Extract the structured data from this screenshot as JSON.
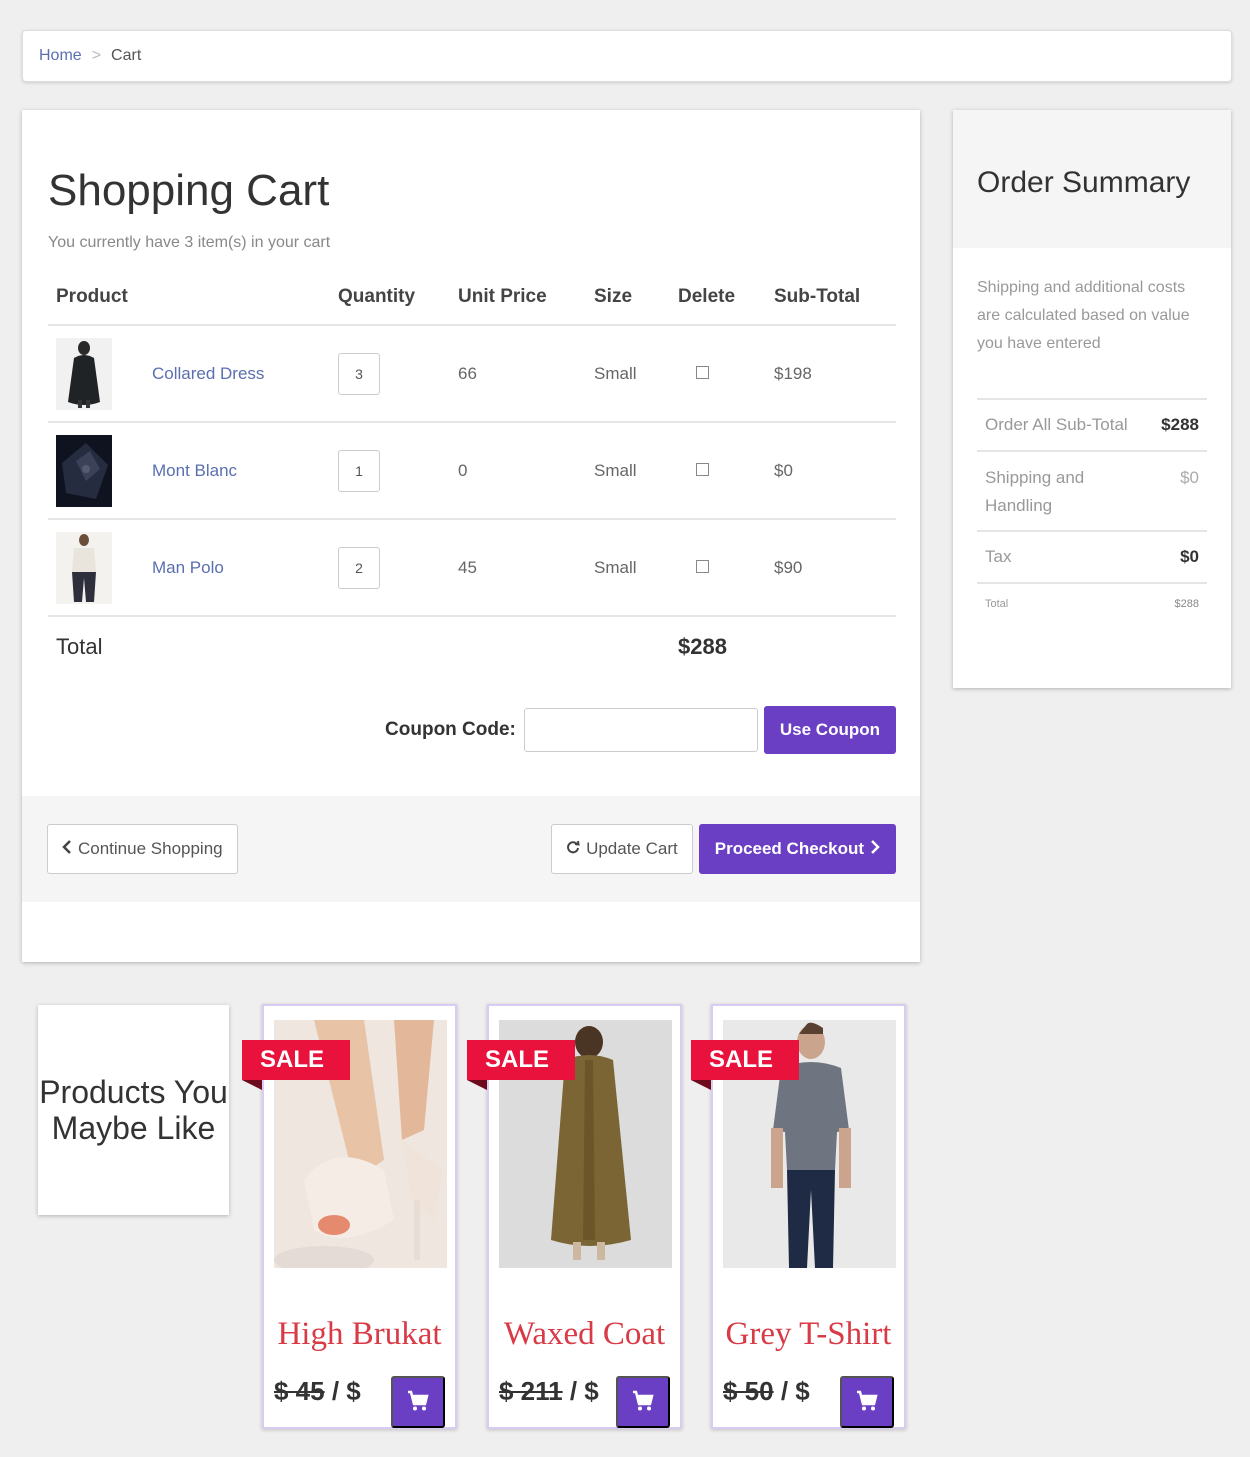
{
  "breadcrumb": {
    "home": "Home",
    "separator": ">",
    "current": "Cart"
  },
  "cart": {
    "title": "Shopping Cart",
    "subtitle": "You currently have 3 item(s) in your cart",
    "headers": {
      "product": "Product",
      "quantity": "Quantity",
      "unit_price": "Unit Price",
      "size": "Size",
      "delete": "Delete",
      "subtotal": "Sub-Total"
    },
    "items": [
      {
        "name": "Collared Dress",
        "qty": "3",
        "price": "66",
        "size": "Small",
        "subtotal": "$198",
        "thumb": "black dress photo"
      },
      {
        "name": "Mont Blanc",
        "qty": "1",
        "price": "0",
        "size": "Small",
        "subtotal": "$0",
        "thumb": "dark bag photo"
      },
      {
        "name": "Man Polo",
        "qty": "2",
        "price": "45",
        "size": "Small",
        "subtotal": "$90",
        "thumb": "white outfit photo"
      }
    ],
    "total_label": "Total",
    "total_value": "$288",
    "coupon_label": "Coupon Code:",
    "coupon_value": "",
    "coupon_button": "Use Coupon",
    "continue_button": "Continue Shopping",
    "update_button": "Update Cart",
    "checkout_button": "Proceed Checkout",
    "accent": "#6a3fc4"
  },
  "summary": {
    "title": "Order Summary",
    "note": "Shipping and additional costs are calculated based on value you have entered",
    "rows": [
      {
        "label": "Order All Sub-Total",
        "value": "$288"
      },
      {
        "label": "Shipping and Handling",
        "value": "$0"
      },
      {
        "label": "Tax",
        "value": "$0"
      },
      {
        "label": "Total",
        "value": "$288"
      }
    ]
  },
  "suggestions": {
    "heading": "Products You Maybe Like",
    "sale_badge": "SALE",
    "products": [
      {
        "name": "High Brukat",
        "old_price": "$ 45",
        "price_suffix": " / $"
      },
      {
        "name": "Waxed Coat",
        "old_price": "$ 211",
        "price_suffix": " / $"
      },
      {
        "name": "Grey T-Shirt",
        "old_price": "$ 50",
        "price_suffix": " / $"
      }
    ],
    "sale_color": "#e8123c",
    "name_color": "#d83a46"
  }
}
